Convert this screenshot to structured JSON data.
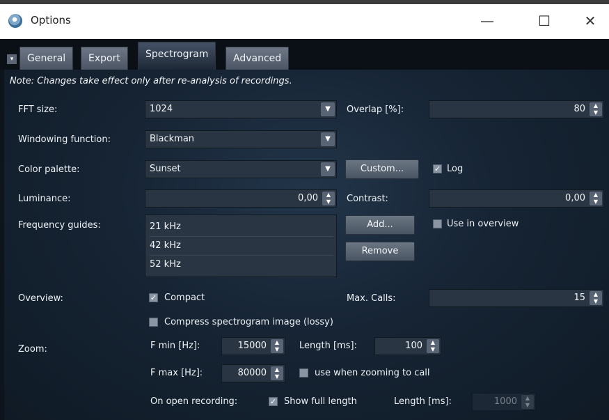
{
  "window": {
    "title": "Options",
    "controls": {
      "minimize": "—",
      "maximize": "☐",
      "close": "✕"
    }
  },
  "tabs": [
    {
      "label": "General",
      "active": false
    },
    {
      "label": "Export",
      "active": false
    },
    {
      "label": "Spectrogram",
      "active": true
    },
    {
      "label": "Advanced",
      "active": false
    }
  ],
  "note": "Note: Changes take effect only after re-analysis of recordings.",
  "fft": {
    "label": "FFT size:",
    "value": "1024"
  },
  "overlap": {
    "label": "Overlap [%]:",
    "value": "80"
  },
  "windowing": {
    "label": "Windowing function:",
    "value": "Blackman"
  },
  "palette": {
    "label": "Color palette:",
    "value": "Sunset",
    "custom_label": "Custom...",
    "log_label": "Log",
    "log_checked": true
  },
  "luminance": {
    "label": "Luminance:",
    "value": "0,00"
  },
  "contrast": {
    "label": "Contrast:",
    "value": "0,00"
  },
  "guides": {
    "label": "Frequency guides:",
    "items": [
      "21 kHz",
      "42 kHz",
      "52 kHz"
    ],
    "add_label": "Add...",
    "remove_label": "Remove",
    "overview_label": "Use in overview",
    "overview_checked": false
  },
  "overview": {
    "label": "Overview:",
    "compact_label": "Compact",
    "compact_checked": true,
    "maxcalls_label": "Max. Calls:",
    "maxcalls_value": "15",
    "compress_label": "Compress spectrogram image (lossy)",
    "compress_checked": false
  },
  "zoom": {
    "label": "Zoom:",
    "fmin_label": "F min [Hz]:",
    "fmin_value": "15000",
    "length_label": "Length [ms]:",
    "length_value": "100",
    "fmax_label": "F max [Hz]:",
    "fmax_value": "80000",
    "usezoom_label": "use when zooming to call",
    "usezoom_checked": false,
    "open_label": "On open recording:",
    "fulllength_label": "Show full length",
    "fulllength_checked": true,
    "open_length_label": "Length [ms]:",
    "open_length_value": "1000"
  },
  "colors": {
    "accent": "#586373",
    "panel": "#162434"
  }
}
